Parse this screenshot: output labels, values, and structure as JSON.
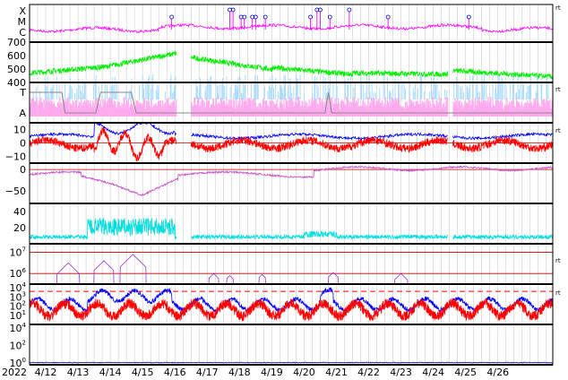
{
  "chart_data": {
    "type": "line",
    "year": "2022",
    "x_dates": [
      "4/12",
      "4/13",
      "4/14",
      "4/15",
      "4/16",
      "4/17",
      "4/18",
      "4/19",
      "4/20",
      "4/21",
      "4/22",
      "4/23",
      "4/24",
      "4/25",
      "4/26"
    ],
    "colors": {
      "magenta": "#ff00ff",
      "green": "#00ee00",
      "lightblue": "#aadcff",
      "pink": "#ffaaee",
      "gray": "#888888",
      "blue": "#0000ff",
      "red": "#ff0000",
      "purple": "#cc55cc",
      "cyan": "#00dddd",
      "darkred": "#cc0000",
      "violet": "#9933cc",
      "navy": "#0000aa",
      "grid": "#cccccc"
    },
    "panels": [
      {
        "id": "xray",
        "ticks": [
          "X",
          "M",
          "C"
        ],
        "right_label": "rt",
        "flares": [
          {
            "t": 4.4,
            "cls": "C"
          },
          {
            "t": 6.2,
            "cls": "M"
          },
          {
            "t": 6.3,
            "cls": "M"
          },
          {
            "t": 6.55,
            "cls": "C"
          },
          {
            "t": 6.65,
            "cls": "C"
          },
          {
            "t": 6.9,
            "cls": "C"
          },
          {
            "t": 7.0,
            "cls": "C"
          },
          {
            "t": 7.3,
            "cls": "C"
          },
          {
            "t": 8.7,
            "cls": "C"
          },
          {
            "t": 8.9,
            "cls": "M"
          },
          {
            "t": 9.0,
            "cls": "M"
          },
          {
            "t": 9.3,
            "cls": "C"
          },
          {
            "t": 9.9,
            "cls": "M"
          },
          {
            "t": 11.1,
            "cls": "C"
          },
          {
            "t": 13.6,
            "cls": "C"
          }
        ]
      },
      {
        "id": "speed",
        "ticks": [
          "700",
          "600",
          "500",
          "400"
        ],
        "ylim": [
          400,
          700
        ]
      },
      {
        "id": "kp",
        "ticks": [
          "T",
          "A"
        ],
        "right_label": "rt"
      },
      {
        "id": "bz",
        "ticks": [
          "10",
          "0",
          "−10"
        ],
        "ylim": [
          -15,
          15
        ],
        "right_label": "rt"
      },
      {
        "id": "dst",
        "ticks": [
          "0",
          "−50"
        ],
        "ylim": [
          -80,
          15
        ]
      },
      {
        "id": "density",
        "ticks": [
          "40",
          "20"
        ],
        "ylim": [
          0,
          50
        ]
      },
      {
        "id": "proton",
        "ticks": [
          "7",
          "6"
        ],
        "ylim": [
          5.5,
          7.4
        ],
        "right_label": "rt"
      },
      {
        "id": "electron",
        "ticks": [
          "4",
          "3",
          "2",
          "1"
        ],
        "ylim": [
          0,
          4.4
        ],
        "right_label": "rt"
      },
      {
        "id": "neutron",
        "ticks": [
          "4",
          "2",
          "0"
        ],
        "ylim": [
          -0.2,
          4.4
        ]
      }
    ]
  }
}
